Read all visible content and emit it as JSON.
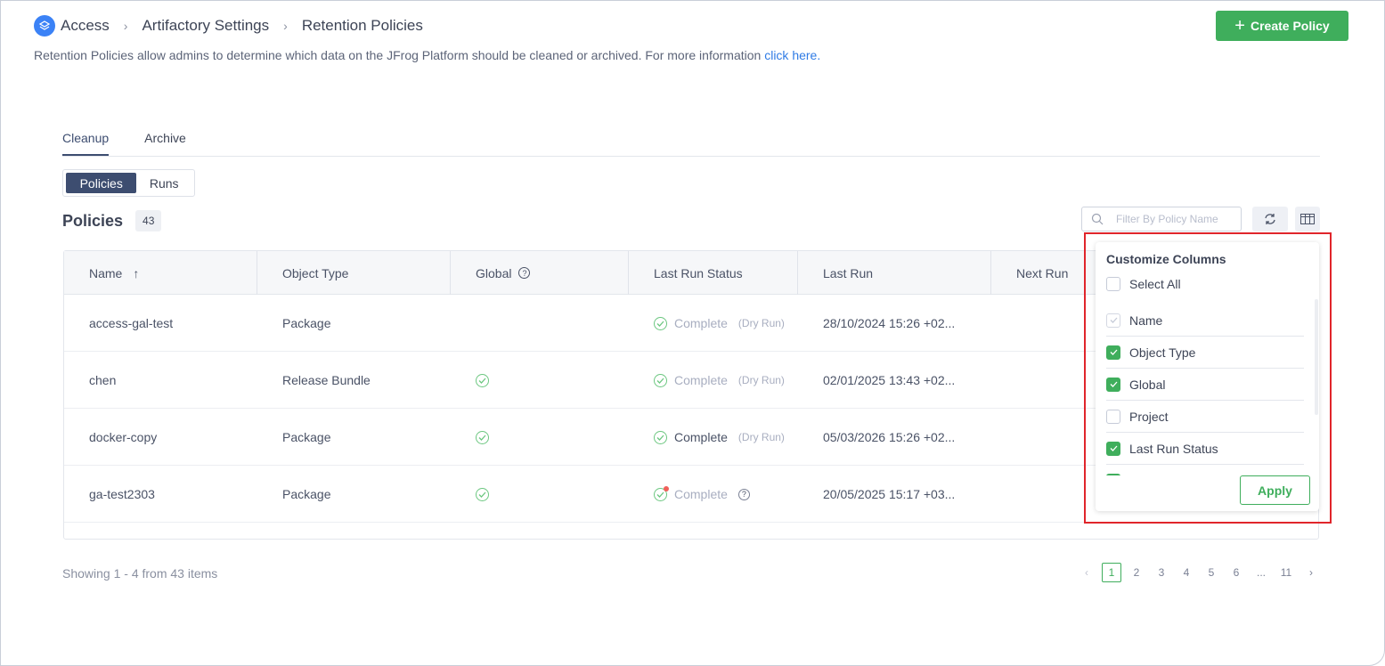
{
  "breadcrumb": [
    "Access",
    "Artifactory Settings",
    "Retention Policies"
  ],
  "description": {
    "text": "Retention Policies allow admins to determine which data on the JFrog Platform should be cleaned or archived. For more information ",
    "link": "click here."
  },
  "create_button": "Create Policy",
  "tabs": [
    {
      "label": "Cleanup",
      "active": true
    },
    {
      "label": "Archive",
      "active": false
    }
  ],
  "segment": [
    {
      "label": "Policies",
      "active": true
    },
    {
      "label": "Runs",
      "active": false
    }
  ],
  "policies": {
    "title": "Policies",
    "count": "43"
  },
  "search": {
    "placeholder": "Filter By Policy Name",
    "value": ""
  },
  "columns": [
    "Name",
    "Object Type",
    "Global",
    "Last Run Status",
    "Last Run",
    "Next Run"
  ],
  "rows": [
    {
      "name": "access-gal-test",
      "object_type": "Package",
      "global": false,
      "status": "Complete",
      "status_note": "(Dry Run)",
      "status_muted": true,
      "last_run": "28/10/2024 15:26 +02..."
    },
    {
      "name": "chen",
      "object_type": "Release Bundle",
      "global": true,
      "status": "Complete",
      "status_note": "(Dry Run)",
      "status_muted": true,
      "last_run": "02/01/2025 13:43 +02..."
    },
    {
      "name": "docker-copy",
      "object_type": "Package",
      "global": true,
      "status": "Complete",
      "status_note": "(Dry Run)",
      "status_muted": false,
      "last_run": "05/03/2026 15:26 +02..."
    },
    {
      "name": "ga-test2303",
      "object_type": "Package",
      "global": true,
      "status": "Complete",
      "status_note": "",
      "status_muted": true,
      "warning": true,
      "last_run": "20/05/2025 15:17 +03..."
    }
  ],
  "footer": {
    "showing": "Showing 1 - 4 from 43 items",
    "pages": [
      "1",
      "2",
      "3",
      "4",
      "5",
      "6",
      "...",
      "11"
    ],
    "current": "1"
  },
  "customize": {
    "title": "Customize Columns",
    "select_all": "Select All",
    "apply": "Apply",
    "options": [
      {
        "label": "Name",
        "checked": true,
        "disabled": true
      },
      {
        "label": "Object Type",
        "checked": true
      },
      {
        "label": "Global",
        "checked": true
      },
      {
        "label": "Project",
        "checked": false
      },
      {
        "label": "Last Run Status",
        "checked": true
      },
      {
        "label": "",
        "checked": true
      }
    ]
  },
  "colors": {
    "accent": "#3fae5c",
    "primary": "#3d4d70",
    "link": "#2f7be5",
    "highlight": "#e0252b"
  }
}
